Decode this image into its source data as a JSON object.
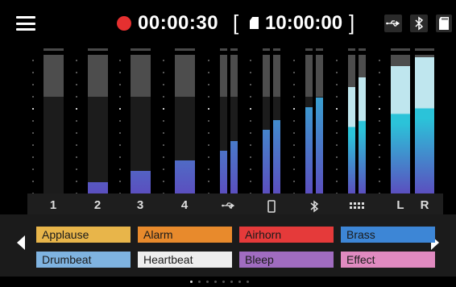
{
  "topbar": {
    "rec_time": "00:00:30",
    "bracket_open": "[",
    "remaining_time": "10:00:00",
    "bracket_close": "]",
    "status_icons": [
      "usb-icon",
      "bluetooth-icon",
      "sd-card-icon"
    ]
  },
  "channels": [
    {
      "label": "1",
      "type": "mono",
      "levels": [
        0.0
      ]
    },
    {
      "label": "2",
      "type": "mono",
      "levels": [
        0.08
      ]
    },
    {
      "label": "3",
      "type": "mono",
      "levels": [
        0.16
      ]
    },
    {
      "label": "4",
      "type": "mono",
      "levels": [
        0.24
      ]
    },
    {
      "label_icon": "usb-icon",
      "type": "stereo",
      "levels": [
        0.31,
        0.38
      ]
    },
    {
      "label_icon": "phone-icon",
      "type": "stereo",
      "levels": [
        0.46,
        0.53
      ]
    },
    {
      "label_icon": "bluetooth-icon",
      "type": "stereo",
      "levels": [
        0.62,
        0.69
      ]
    },
    {
      "label_icon": "pads-icon",
      "type": "stereo",
      "levels": [
        0.77,
        0.84
      ]
    },
    {
      "label": "L",
      "type": "master",
      "levels": [
        0.92
      ]
    },
    {
      "label": "R",
      "type": "master",
      "levels": [
        0.98
      ]
    }
  ],
  "pads": [
    {
      "label": "Applause",
      "bg": "#e8b54a",
      "fg": "#1a1a1a"
    },
    {
      "label": "Alarm",
      "bg": "#e88a2c",
      "fg": "#1a1a1a"
    },
    {
      "label": "Airhorn",
      "bg": "#e53a3a",
      "fg": "#1a1a1a"
    },
    {
      "label": "Brass",
      "bg": "#3d86d6",
      "fg": "#1a1a1a"
    },
    {
      "label": "Drumbeat",
      "bg": "#7fb3e0",
      "fg": "#1a1a1a"
    },
    {
      "label": "Heartbeat",
      "bg": "#eeeeee",
      "fg": "#1a1a1a"
    },
    {
      "label": "Bleep",
      "bg": "#a06cc0",
      "fg": "#1a1a1a"
    },
    {
      "label": "Effect",
      "bg": "#e08ac0",
      "fg": "#1a1a1a"
    }
  ],
  "pager": {
    "pages": 8,
    "current": 1
  },
  "colors": {
    "rec": "#e53030",
    "meter_low": "#5b4fbf",
    "meter_high": "#2bc3d9",
    "meter_peak": "#bfe6ee"
  }
}
